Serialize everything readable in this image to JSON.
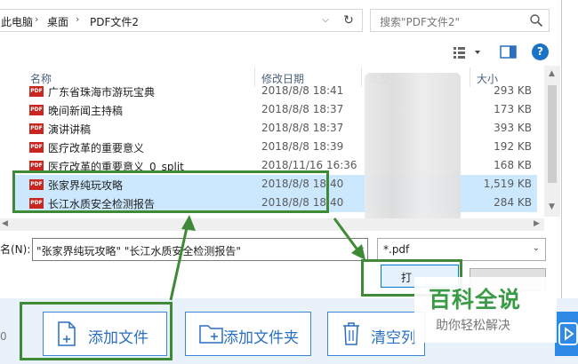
{
  "address_bar": {
    "crumbs": [
      "此电脑",
      "桌面",
      "PDF文件2"
    ],
    "separator": "›"
  },
  "search": {
    "placeholder": "搜索\"PDF文件2\""
  },
  "toolbar": {
    "help_label": "?"
  },
  "columns": {
    "name": "名称",
    "date": "修改日期",
    "type": "类型",
    "size": "大小"
  },
  "files": [
    {
      "name": "广东省珠海市游玩宝典",
      "date": "2018/8/8 18:41",
      "size": "293 KB",
      "selected": false
    },
    {
      "name": "晚间新闻主持稿",
      "date": "2018/8/8 18:37",
      "size": "173 KB",
      "selected": false
    },
    {
      "name": "演讲讲稿",
      "date": "2018/8/8 18:37",
      "size": "393 KB",
      "selected": false
    },
    {
      "name": "医疗改革的重要意义",
      "date": "2018/8/8 18:39",
      "size": "192 KB",
      "selected": false
    },
    {
      "name": "医疗改革的重要意义_0_split",
      "date": "2018/11/16 16:36",
      "size": "168 KB",
      "selected": false
    },
    {
      "name": "张家界纯玩攻略",
      "date": "2018/8/8 18:40",
      "size": "1,519 KB",
      "selected": true
    },
    {
      "name": "长江水质安全检测报告",
      "date": "2018/8/8 18:40",
      "size": "284 KB",
      "selected": true
    }
  ],
  "file_icon_label": "PDF",
  "filename": {
    "label": "名(N):",
    "value": "\"张家界纯玩攻略\" \"长江水质安全检测报告\""
  },
  "file_type": {
    "value": "*.pdf"
  },
  "buttons": {
    "open": "打"
  },
  "appbar": {
    "counter": "0",
    "add_file": "添加文件",
    "add_folder": "添加文件夹",
    "clear": "清空列"
  },
  "watermark": {
    "title": "百科全说",
    "subtitle": "助你轻松解决"
  },
  "colors": {
    "selection": "#cce8ff",
    "annotation": "#3f8a36",
    "accent": "#2a6fc0"
  }
}
